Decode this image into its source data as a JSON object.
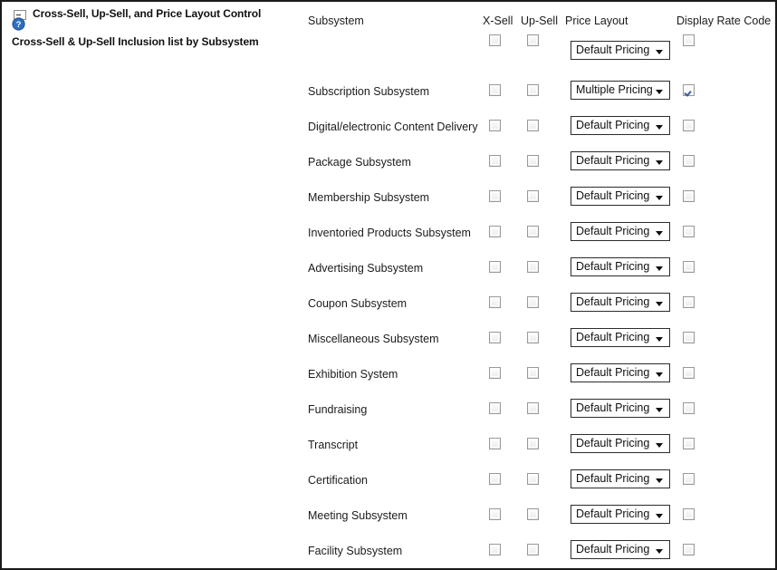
{
  "panel": {
    "title": "Cross-Sell, Up-Sell, and Price Layout Control",
    "subtitle": "Cross-Sell & Up-Sell Inclusion list by Subsystem",
    "collapse_icon": "collapse-minus-icon",
    "help_icon": "help-question-icon"
  },
  "columns": {
    "subsystem": "Subsystem",
    "x_sell": "X-Sell",
    "up_sell": "Up-Sell",
    "price_layout": "Price Layout",
    "display_rate_code": "Display Rate Code"
  },
  "header_controls": {
    "x_sell_checked": false,
    "up_sell_checked": false,
    "price_layout_value": "Default Pricing",
    "display_rate_code_checked": false
  },
  "price_layout_options": [
    "Default Pricing",
    "Multiple Pricing"
  ],
  "rows": [
    {
      "label": "Subscription Subsystem",
      "x_sell": false,
      "up_sell": false,
      "price_layout": "Multiple Pricing",
      "rate_code": true
    },
    {
      "label": "Digital/electronic Content Delivery",
      "x_sell": false,
      "up_sell": false,
      "price_layout": "Default Pricing",
      "rate_code": false
    },
    {
      "label": "Package Subsystem",
      "x_sell": false,
      "up_sell": false,
      "price_layout": "Default Pricing",
      "rate_code": false
    },
    {
      "label": "Membership Subsystem",
      "x_sell": false,
      "up_sell": false,
      "price_layout": "Default Pricing",
      "rate_code": false
    },
    {
      "label": "Inventoried Products Subsystem",
      "x_sell": false,
      "up_sell": false,
      "price_layout": "Default Pricing",
      "rate_code": false
    },
    {
      "label": "Advertising Subsystem",
      "x_sell": false,
      "up_sell": false,
      "price_layout": "Default Pricing",
      "rate_code": false
    },
    {
      "label": "Coupon Subsystem",
      "x_sell": false,
      "up_sell": false,
      "price_layout": "Default Pricing",
      "rate_code": false
    },
    {
      "label": "Miscellaneous Subsystem",
      "x_sell": false,
      "up_sell": false,
      "price_layout": "Default Pricing",
      "rate_code": false
    },
    {
      "label": "Exhibition System",
      "x_sell": false,
      "up_sell": false,
      "price_layout": "Default Pricing",
      "rate_code": false
    },
    {
      "label": "Fundraising",
      "x_sell": false,
      "up_sell": false,
      "price_layout": "Default Pricing",
      "rate_code": false
    },
    {
      "label": "Transcript",
      "x_sell": false,
      "up_sell": false,
      "price_layout": "Default Pricing",
      "rate_code": false
    },
    {
      "label": "Certification",
      "x_sell": false,
      "up_sell": false,
      "price_layout": "Default Pricing",
      "rate_code": false
    },
    {
      "label": "Meeting Subsystem",
      "x_sell": false,
      "up_sell": false,
      "price_layout": "Default Pricing",
      "rate_code": false
    },
    {
      "label": "Facility Subsystem",
      "x_sell": false,
      "up_sell": false,
      "price_layout": "Default Pricing",
      "rate_code": false
    }
  ],
  "colors": {
    "border": "#1a1a1a",
    "text": "#1b1b1b",
    "title": "#111111",
    "help_icon_blue": "#2f6fbf",
    "check_blue": "#3a5b9e"
  }
}
